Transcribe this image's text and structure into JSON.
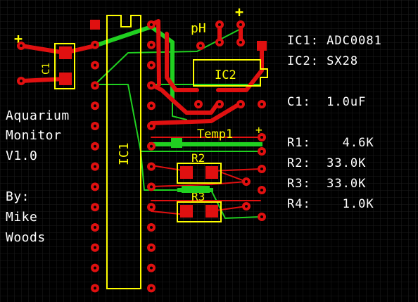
{
  "colors": {
    "background": "#000000",
    "grid": "#1c1c1c",
    "copper_top": "#e01010",
    "copper_bottom": "#20d020",
    "silkscreen": "#ffff00",
    "text": "#ffffff"
  },
  "silkscreen_labels": {
    "ic1": "IC1",
    "ic2": "IC2",
    "r2": "R2",
    "r3": "R3",
    "ph": "pH",
    "temp1": "Temp1",
    "c1": "C1",
    "plus_ph": "+",
    "plus_temp": "+",
    "plus_cap": "+"
  },
  "title_block": {
    "lines": [
      "Aquarium",
      "Monitor",
      "V1.0",
      "",
      "By:",
      "Mike",
      "Woods"
    ]
  },
  "parts_list": [
    "IC1: ADC0081",
    "IC2: SX28",
    "",
    "C1:  1.0uF",
    "",
    "R1:    4.6K",
    "R2:  33.0K",
    "R3:  33.0K",
    "R4:    1.0K"
  ]
}
